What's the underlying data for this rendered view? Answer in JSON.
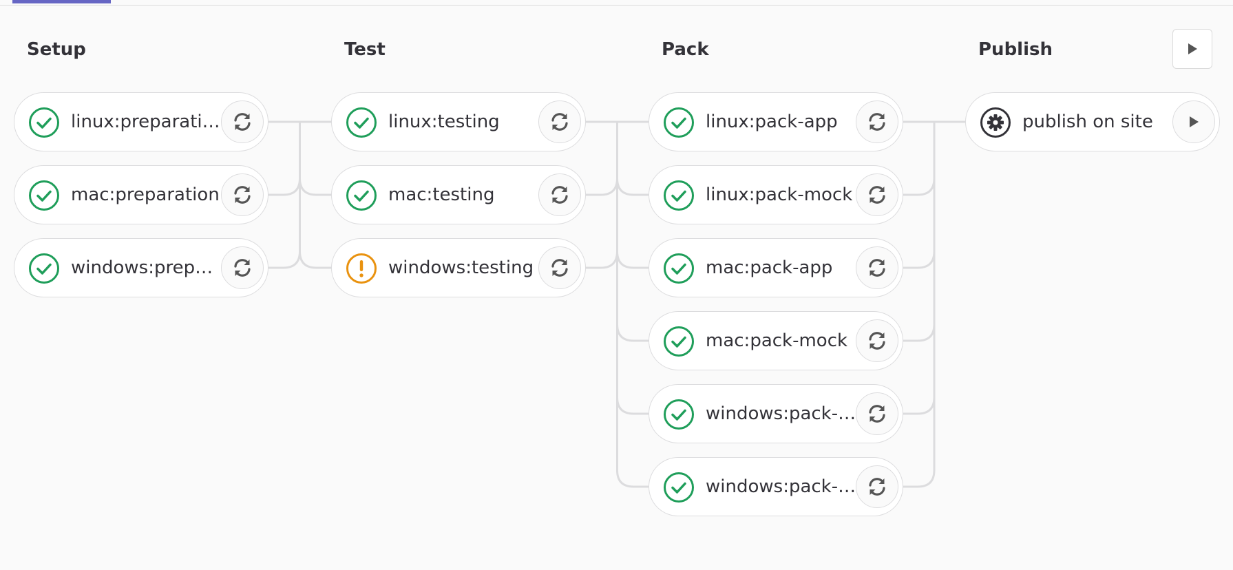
{
  "colors": {
    "success": "#1f9e5a",
    "warning": "#e9920f",
    "manual": "#333238",
    "tab_accent": "#6666c4",
    "connector": "#dcdcde"
  },
  "stages": [
    {
      "title": "Setup",
      "jobs": [
        {
          "name": "linux:preparation",
          "status": "success",
          "action": "retry-icon"
        },
        {
          "name": "mac:preparation",
          "status": "success",
          "action": "retry-icon"
        },
        {
          "name": "windows:preparation",
          "status": "success",
          "action": "retry-icon"
        }
      ]
    },
    {
      "title": "Test",
      "jobs": [
        {
          "name": "linux:testing",
          "status": "success",
          "action": "retry-icon"
        },
        {
          "name": "mac:testing",
          "status": "success",
          "action": "retry-icon"
        },
        {
          "name": "windows:testing",
          "status": "warning",
          "action": "retry-icon"
        }
      ]
    },
    {
      "title": "Pack",
      "jobs": [
        {
          "name": "linux:pack-app",
          "status": "success",
          "action": "retry-icon"
        },
        {
          "name": "linux:pack-mock",
          "status": "success",
          "action": "retry-icon"
        },
        {
          "name": "mac:pack-app",
          "status": "success",
          "action": "retry-icon"
        },
        {
          "name": "mac:pack-mock",
          "status": "success",
          "action": "retry-icon"
        },
        {
          "name": "windows:pack-app",
          "status": "success",
          "action": "retry-icon"
        },
        {
          "name": "windows:pack-mock",
          "status": "success",
          "action": "retry-icon"
        }
      ]
    },
    {
      "title": "Publish",
      "stage_action": "play-icon",
      "jobs": [
        {
          "name": "publish on site",
          "status": "manual",
          "action": "play-icon"
        }
      ]
    }
  ]
}
